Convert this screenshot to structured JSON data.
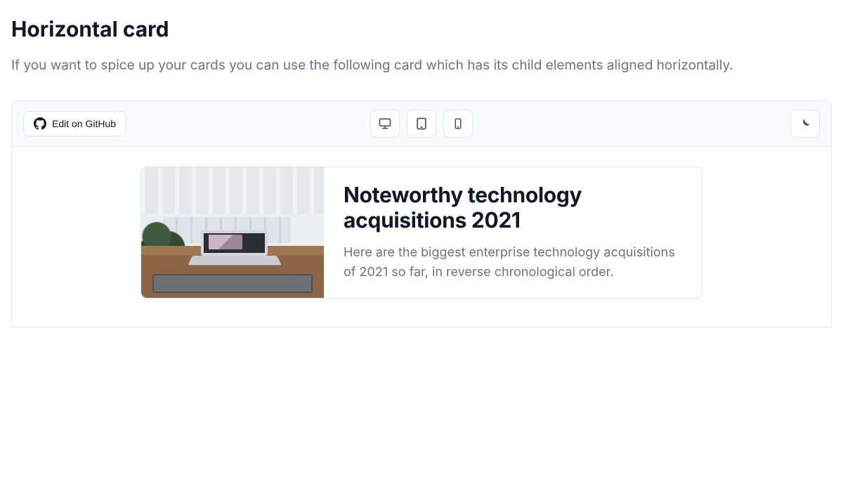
{
  "section": {
    "title": "Horizontal card",
    "description": "If you want to spice up your cards you can use the following card which has its child elements aligned horizontally."
  },
  "toolbar": {
    "github_label": "Edit on GitHub"
  },
  "card": {
    "title": "Noteworthy technology acquisitions 2021",
    "body": "Here are the biggest enterprise technology acquisitions of 2021 so far, in reverse chronological order."
  }
}
